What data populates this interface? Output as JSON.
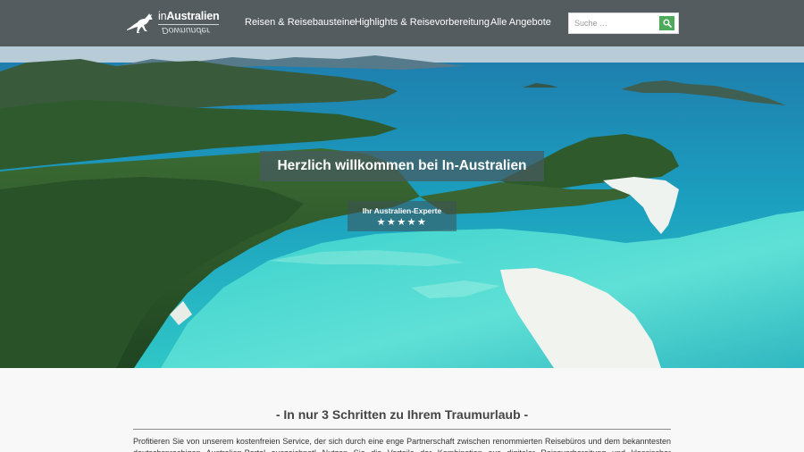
{
  "brand": {
    "logo_in": "in",
    "logo_name": "Australien",
    "logo_sub": "Downunder"
  },
  "nav": {
    "items": [
      {
        "label": "Reisen & Reisebausteine"
      },
      {
        "label": "Highlights & Reisevorbereitung"
      },
      {
        "label": "Alle Angebote"
      }
    ]
  },
  "search": {
    "placeholder": "Suche …",
    "value": ""
  },
  "hero": {
    "title": "Herzlich willkommen bei In-Australien",
    "subtitle": "Ihr Australien-Experte",
    "stars": "★★★★★",
    "rating": 5
  },
  "content": {
    "section_title": "- In nur 3 Schritten zu Ihrem Traumurlaub -",
    "paragraph": "Profitieren Sie von unserem kostenfreien Service, der sich durch eine enge Partnerschaft zwischen renommierten Reisebüros und dem bekanntesten deutschsprachigen Australien-Portal auszeichnet! Nutzen Sie die Vorteile der Kombination aus digitaler Reisevorbereitung und klassischer Reisebuchung vom"
  },
  "colors": {
    "header_bg": "#545c5f",
    "search_button": "#4caa5a",
    "page_bg": "#f8f8f8"
  },
  "icons": {
    "logo": "kangaroo-icon",
    "search": "search-icon",
    "rating": "star-icon"
  }
}
